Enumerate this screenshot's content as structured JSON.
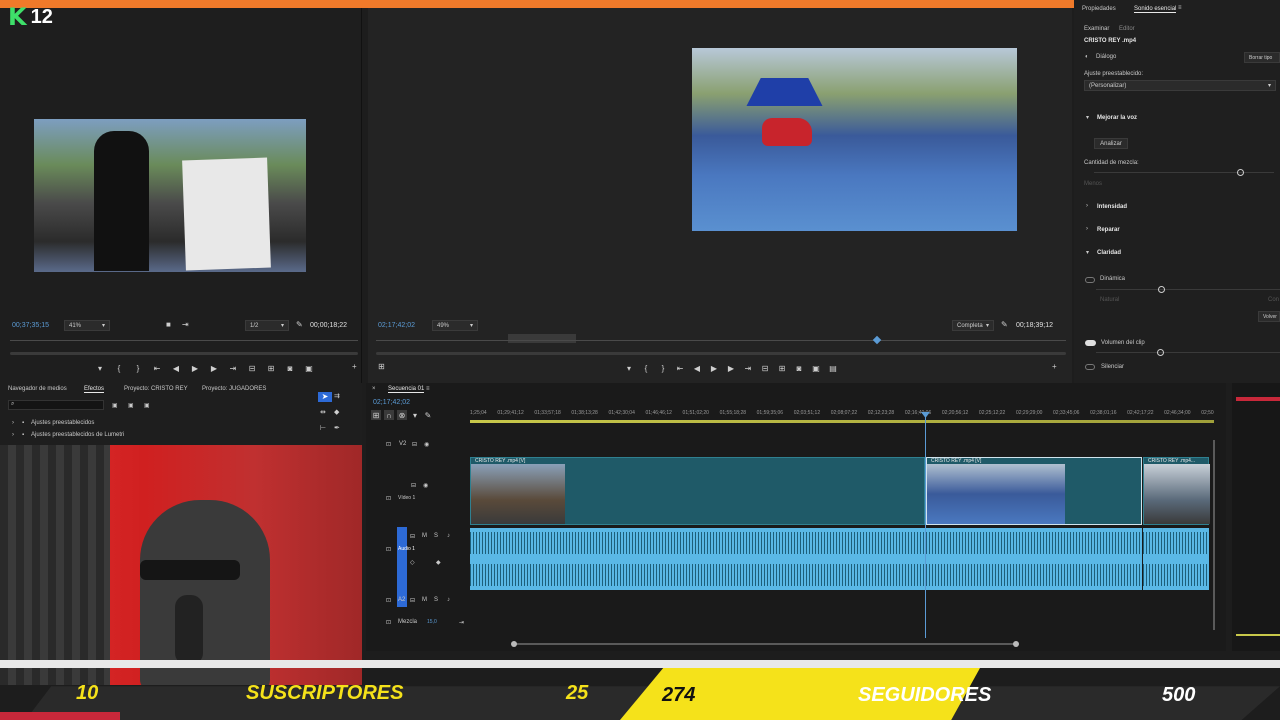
{
  "overlay": {
    "channel_letter": "K",
    "channel_number": "12"
  },
  "source_monitor": {
    "timecode_in": "00;37;35;15",
    "zoom": "41%",
    "resolution": "1/2",
    "duration": "00;00;18;22"
  },
  "program_monitor": {
    "timecode": "02;17;42;02",
    "zoom": "49%",
    "quality": "Completa",
    "duration": "00;18;39;12"
  },
  "essential_sound": {
    "tab_properties": "Propiedades",
    "tab_sound": "Sonido esencial",
    "sub_tab_examiner": "Examinar",
    "sub_tab_editor": "Editor",
    "clip_name": "CRISTO REY .mp4",
    "type_label": "Diálogo",
    "clear_type": "Borrar tipo",
    "preset_label": "Ajuste preestablecido:",
    "preset_value": "(Personalizar)",
    "improve_voice": "Mejorar la voz",
    "analyze": "Analizar",
    "mix_amount": "Cantidad de mezcla:",
    "less": "Menos",
    "intensity": "Intensidad",
    "repair": "Reparar",
    "clarity": "Claridad",
    "dynamics": "Dinámica",
    "natural": "Natural",
    "con": "Con",
    "volver": "Volver",
    "clip_volume": "Volumen del clip",
    "mute": "Silenciar"
  },
  "effects": {
    "tab_media_browser": "Navegador de medios",
    "tab_effects": "Efectos",
    "tab_project1": "Proyecto: CRISTO REY",
    "tab_project2": "Proyecto: JUGADORES",
    "item1": "Ajustes preestablecidos",
    "item2": "Ajustes preestablecidos de Lumetri"
  },
  "timeline": {
    "sequence_name": "Secuencia 01",
    "playhead_tc": "02;17;42;02",
    "ruler_ticks": [
      "1;25;04",
      "01;29;41;12",
      "01;33;57;18",
      "01;38;13;28",
      "01;42;30;04",
      "01;46;46;12",
      "01;51;02;20",
      "01;55;18;28",
      "01;59;35;06",
      "02;03;51;12",
      "02;08;07;22",
      "02;12;23;28",
      "02;16;40;06",
      "02;20;56;12",
      "02;25;12;22",
      "02;29;29;00",
      "02;33;45;06",
      "02;38;01;16",
      "02;42;17;22",
      "02;46;34;00",
      "02;50"
    ],
    "track_v2": "V2",
    "track_v1": "Vídeo 1",
    "track_a1": "Audio 1",
    "track_a2": "A2",
    "mix_label": "Mezcla",
    "mix_value": "15,0",
    "clip1_label": "CRISTO REY .mp4 [V]",
    "clip2_label": "CRISTO REY .mp4 [V]",
    "clip3_label": "CRISTO REY .mp4..."
  },
  "stats": {
    "subs_current": "10",
    "subs_label": "SUSCRIPTORES",
    "subs_goal": "25",
    "followers_current": "274",
    "followers_label": "SEGUIDORES",
    "followers_goal": "500"
  },
  "colors": {
    "accent": "#f07a2a",
    "timecode": "#5b9bd5",
    "clip_video": "#1f5a68",
    "clip_audio": "#5ab8e6",
    "follower_yellow": "#f5e21a"
  }
}
